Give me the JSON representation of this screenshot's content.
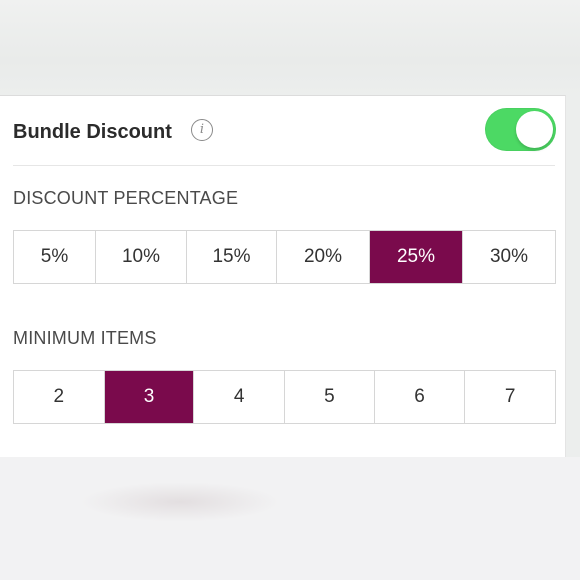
{
  "bundle": {
    "title": "Bundle Discount",
    "info_icon": "info-circle-icon",
    "toggle_on": true
  },
  "discount": {
    "label": "DISCOUNT PERCENTAGE",
    "options": [
      "5%",
      "10%",
      "15%",
      "20%",
      "25%",
      "30%"
    ],
    "selected": "25%"
  },
  "minimum": {
    "label": "MINIMUM ITEMS",
    "options": [
      "2",
      "3",
      "4",
      "5",
      "6",
      "7"
    ],
    "selected": "3"
  },
  "colors": {
    "accent": "#7a0a4c",
    "toggle_on": "#4cd964"
  }
}
